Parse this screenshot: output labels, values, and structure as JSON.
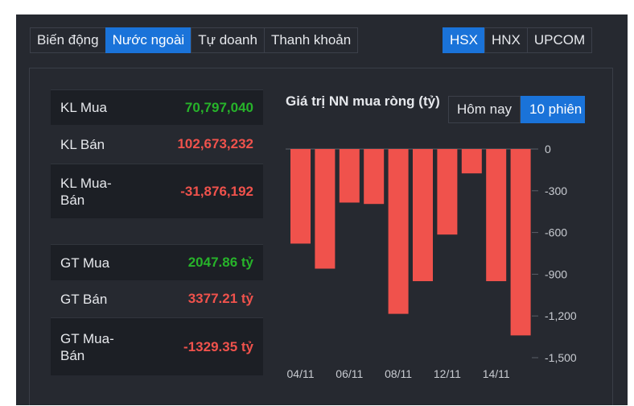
{
  "tabs": [
    {
      "label": "Biến động",
      "active": false
    },
    {
      "label": "Nước ngoài",
      "active": true
    },
    {
      "label": "Tự doanh",
      "active": false
    },
    {
      "label": "Thanh khoản",
      "active": false
    }
  ],
  "exchanges": [
    {
      "label": "HSX",
      "active": true
    },
    {
      "label": "HNX",
      "active": false
    },
    {
      "label": "UPCOM",
      "active": false
    }
  ],
  "stats": [
    {
      "label": "KL Mua",
      "value": "70,797,040",
      "color": "#27b32a"
    },
    {
      "label": "KL Bán",
      "value": "102,673,232",
      "color": "#f0524c"
    },
    {
      "label": "KL Mua-Bán",
      "value": "-31,876,192",
      "color": "#f0524c"
    },
    {
      "label": "GT Mua",
      "value": "2047.86 tỷ",
      "color": "#27b32a"
    },
    {
      "label": "GT Bán",
      "value": "3377.21 tỷ",
      "color": "#f0524c"
    },
    {
      "label": "GT Mua-Bán",
      "value": "-1329.35 tỷ",
      "color": "#f0524c"
    }
  ],
  "period": {
    "today": "Hôm nay",
    "ten_sessions": "10 phiên"
  },
  "chart_data": {
    "type": "bar",
    "title": "Giá trị NN mua ròng (tỷ)",
    "values": [
      -680,
      -860,
      -385,
      -395,
      -1185,
      -950,
      -615,
      -175,
      -950,
      -1340
    ],
    "x_tick_labels": [
      "04/11",
      "06/11",
      "08/11",
      "12/11",
      "14/11"
    ],
    "y_ticks": [
      0,
      -300,
      -600,
      -900,
      -1200,
      -1500
    ],
    "y_tick_labels": [
      "0",
      "-300",
      "-600",
      "-900",
      "-1,200",
      "-1,500"
    ],
    "ylim": [
      -1500,
      0
    ],
    "bar_color": "#f0524c",
    "grid": false,
    "legend": "none"
  }
}
